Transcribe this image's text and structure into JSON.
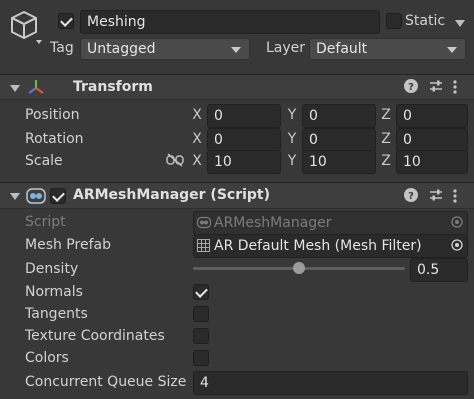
{
  "object": {
    "name": "Meshing",
    "active": true,
    "static_label": "Static",
    "static_checked": false,
    "tag_label": "Tag",
    "tag_value": "Untagged",
    "layer_label": "Layer",
    "layer_value": "Default"
  },
  "transform": {
    "title": "Transform",
    "rows": [
      {
        "label": "Position",
        "x": "0",
        "y": "0",
        "z": "0"
      },
      {
        "label": "Rotation",
        "x": "0",
        "y": "0",
        "z": "0"
      },
      {
        "label": "Scale",
        "x": "10",
        "y": "10",
        "z": "10"
      }
    ],
    "axes": {
      "x": "X",
      "y": "Y",
      "z": "Z"
    }
  },
  "armesh": {
    "title": "ARMeshManager (Script)",
    "enabled": true,
    "script_label": "Script",
    "script_value": "ARMeshManager",
    "mesh_prefab_label": "Mesh Prefab",
    "mesh_prefab_value": "AR Default Mesh (Mesh Filter)",
    "density_label": "Density",
    "density_value": "0.5",
    "density_fraction": 0.5,
    "normals_label": "Normals",
    "normals": true,
    "tangents_label": "Tangents",
    "tangents": false,
    "texcoords_label": "Texture Coordinates",
    "texcoords": false,
    "colors_label": "Colors",
    "colors": false,
    "queue_label": "Concurrent Queue Size",
    "queue_value": "4"
  },
  "colors": {
    "background": "#383838",
    "field": "#2a2a2a",
    "header": "#3e3e3e"
  }
}
